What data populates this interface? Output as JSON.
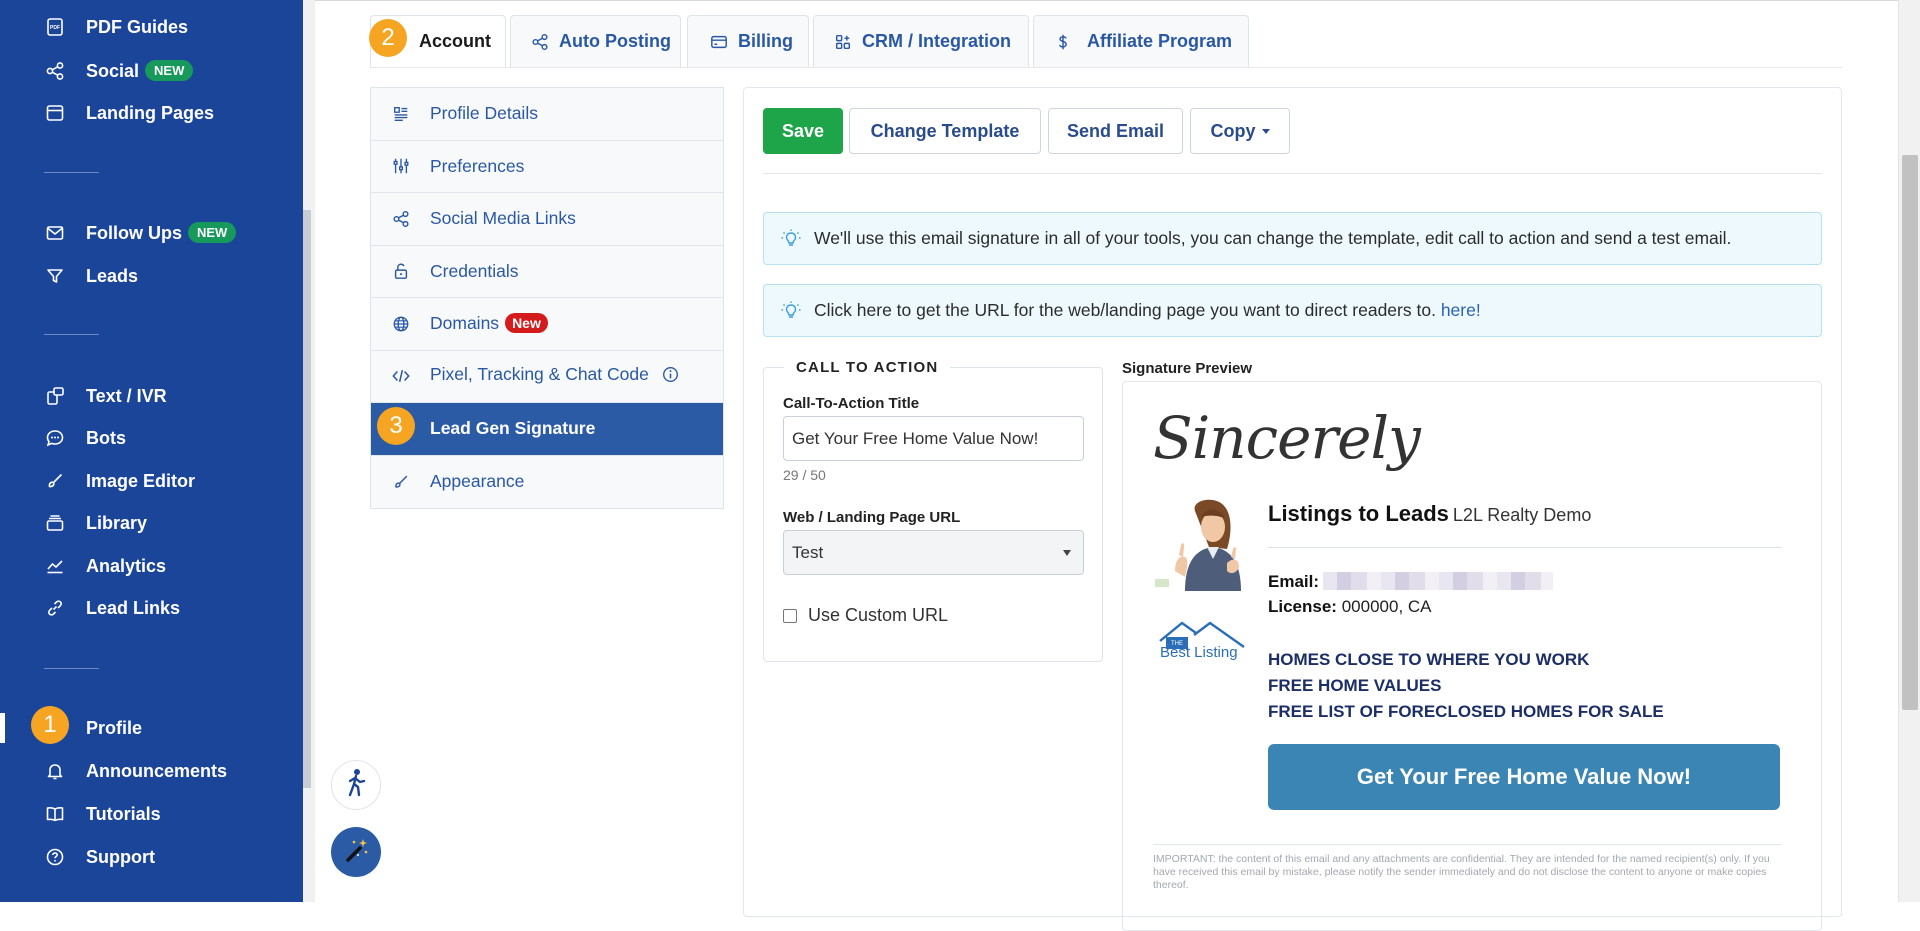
{
  "sidebar": {
    "items": [
      {
        "label": "PDF Guides",
        "icon": "pdf-icon"
      },
      {
        "label": "Social",
        "badge": "NEW",
        "icon": "share-icon"
      },
      {
        "label": "Landing Pages",
        "icon": "browser-icon"
      },
      {
        "label": "Follow Ups",
        "badge": "NEW",
        "icon": "mail-icon"
      },
      {
        "label": "Leads",
        "icon": "filter-icon"
      },
      {
        "label": "Text / IVR",
        "icon": "phone-chat-icon"
      },
      {
        "label": "Bots",
        "icon": "chat-bubble-icon"
      },
      {
        "label": "Image Editor",
        "icon": "brush-icon"
      },
      {
        "label": "Library",
        "icon": "stack-icon"
      },
      {
        "label": "Analytics",
        "icon": "chart-icon"
      },
      {
        "label": "Lead Links",
        "icon": "link-icon"
      },
      {
        "label": "Profile",
        "icon": "user-icon"
      },
      {
        "label": "Announcements",
        "icon": "bell-icon"
      },
      {
        "label": "Tutorials",
        "icon": "book-icon"
      },
      {
        "label": "Support",
        "icon": "help-icon"
      }
    ]
  },
  "steps": {
    "one": "1",
    "two": "2",
    "three": "3"
  },
  "tabs": [
    {
      "label": "Account"
    },
    {
      "label": "Auto Posting",
      "icon": "share-icon"
    },
    {
      "label": "Billing",
      "icon": "credit-card-icon"
    },
    {
      "label": "CRM / Integration",
      "icon": "apps-icon"
    },
    {
      "label": "Affiliate Program",
      "icon": "dollar-icon"
    }
  ],
  "submenu": [
    {
      "label": "Profile Details",
      "icon": "list-icon"
    },
    {
      "label": "Preferences",
      "icon": "sliders-icon"
    },
    {
      "label": "Social Media Links",
      "icon": "share-icon"
    },
    {
      "label": "Credentials",
      "icon": "lock-icon"
    },
    {
      "label": "Domains",
      "badge": "New",
      "icon": "globe-icon"
    },
    {
      "label": "Pixel, Tracking & Chat Code",
      "icon": "code-icon"
    },
    {
      "label": "Lead Gen Signature",
      "active": true
    },
    {
      "label": "Appearance",
      "icon": "brush-icon"
    }
  ],
  "toolbar": {
    "save": "Save",
    "change_template": "Change Template",
    "send_email": "Send Email",
    "copy": "Copy"
  },
  "alerts": {
    "info1": "We'll use this email signature in all of your tools, you can change the template, edit call to action and send a test email.",
    "info2": "Click here to get the URL for the web/landing page you want to direct readers to.",
    "info2_link": "here!"
  },
  "cta": {
    "legend": "CALL TO ACTION",
    "title_label": "Call-To-Action Title",
    "title_value": "Get Your Free Home Value Now!",
    "char_count": "29 / 50",
    "url_label": "Web / Landing Page URL",
    "url_value": "Test",
    "custom_url_label": "Use Custom URL"
  },
  "signature": {
    "preview_title": "Signature Preview",
    "closing": "Sincerely",
    "name": "Listings to Leads",
    "company": "L2L Realty Demo",
    "email_label": "Email:",
    "license_label": "License:",
    "license_value": "000000, CA",
    "bullets": [
      "HOMES CLOSE TO WHERE YOU WORK",
      "FREE HOME VALUES",
      "FREE LIST OF FORECLOSED HOMES FOR SALE"
    ],
    "button": "Get Your Free Home Value Now!",
    "logo_text_top": "THE",
    "logo_text": "Best Listing",
    "disclaimer": "IMPORTANT: the content of this email and any attachments are confidential. They are intended for the named recipient(s) only. If you have received this email by mistake, please notify the sender immediately and do not disclose the content to anyone or make copies thereof."
  },
  "colors": {
    "sidebar": "#1b4599",
    "accent": "#2c5ba6",
    "save": "#1ea54a",
    "step": "#f5a521",
    "cta_button": "#3a85b3"
  }
}
